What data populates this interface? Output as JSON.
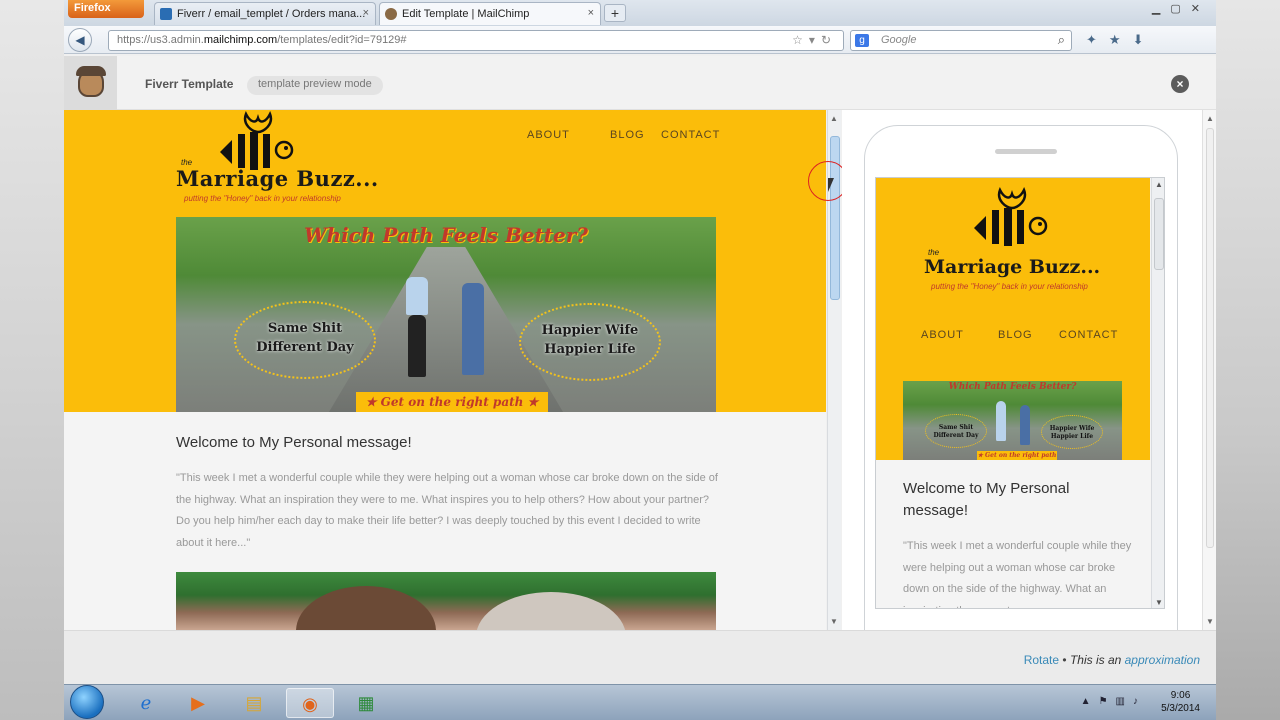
{
  "browser": {
    "menu_button": "Firefox",
    "tabs": [
      {
        "label": "Fiverr / email_templet / Orders mana...",
        "close": "×"
      },
      {
        "label": "Edit Template | MailChimp",
        "close": "×"
      }
    ],
    "new_tab": "+",
    "url_prefix": "https://us3.admin.",
    "url_domain": "mailchimp.com",
    "url_suffix": "/templates/edit?id=79129#",
    "search_engine": "g",
    "search_placeholder": "Google"
  },
  "editor": {
    "template_name": "Fiverr Template",
    "mode_label": "template preview mode",
    "close_label": "×"
  },
  "email": {
    "logo_the": "the",
    "logo_title": "Marriage Buzz...",
    "logo_tagline": "putting the \"Honey\" back in your relationship",
    "nav": [
      "ABOUT",
      "BLOG",
      "CONTACT"
    ],
    "hero_title": "Which Path Feels Better?",
    "hero_left_line1": "Same Shit",
    "hero_left_line2": "Different Day",
    "hero_right_line1": "Happier Wife",
    "hero_right_line2": "Happier Life",
    "hero_banner": "★ Get on the right path ★",
    "heading": "Welcome to My Personal message!",
    "body": "\"This week I met a wonderful couple while they were helping out a woman whose car broke down on the side of the highway. What an inspiration they were to me. What inspires you to help others? How about your partner? Do you help him/her each day to make their life better? I was deeply touched by this event I decided to write about it here...\"",
    "mobile_body": "\"This week I met a wonderful couple while they were helping out a woman whose car broke down on the side of the highway. What an inspiration they were to me."
  },
  "footer": {
    "rotate": "Rotate",
    "separator": " • ",
    "this_is_an": "This is an ",
    "approximation": "approximation"
  },
  "taskbar": {
    "time": "9:06",
    "date": "5/3/2014"
  },
  "colors": {
    "email_header_bg": "#fbbd0a",
    "hero_title_red": "#c0392b",
    "link_blue": "#3a8ab8"
  }
}
